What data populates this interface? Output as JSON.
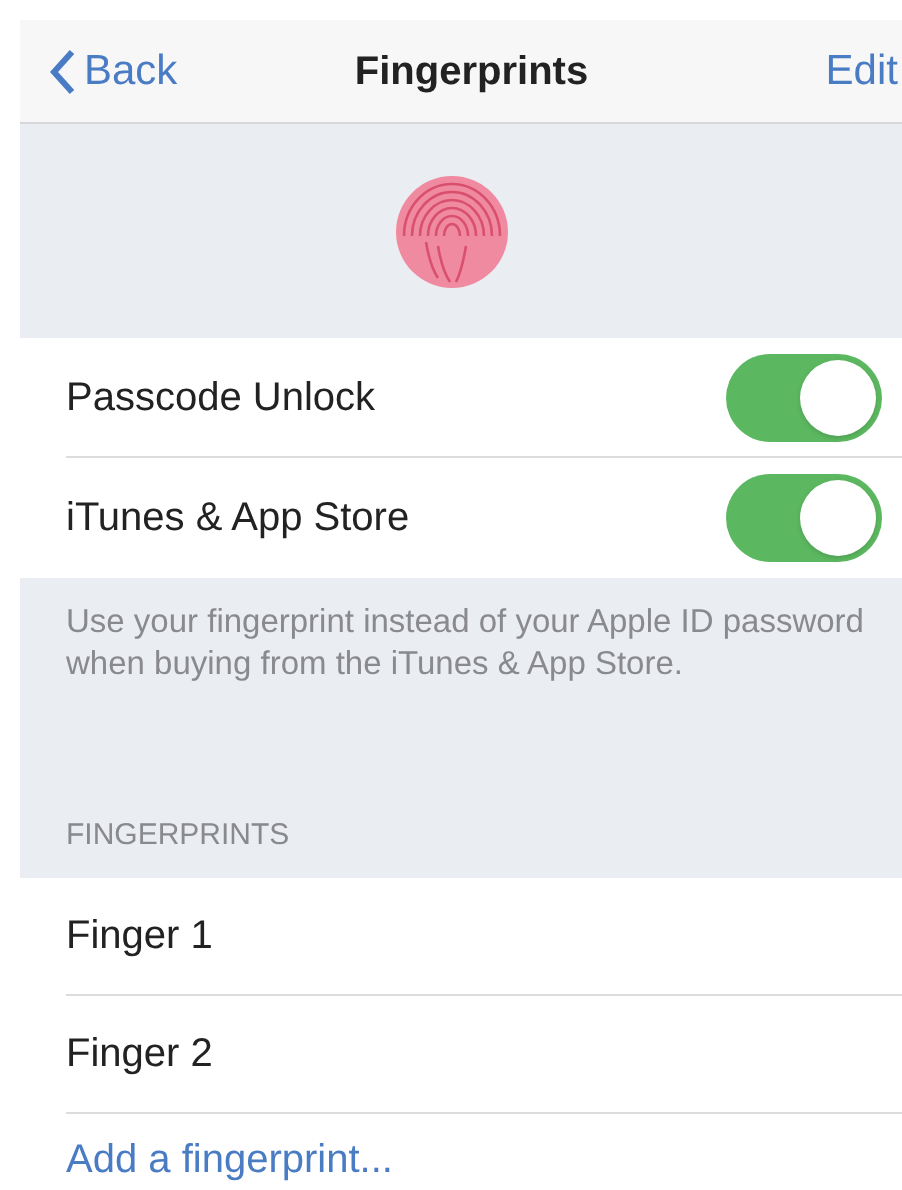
{
  "nav": {
    "back": "Back",
    "title": "Fingerprints",
    "action": "Edit"
  },
  "toggles": [
    {
      "label": "Passcode Unlock",
      "on": true
    },
    {
      "label": "iTunes & App Store",
      "on": true
    }
  ],
  "footer_note": "Use your fingerprint instead of your Apple ID password when buying from the iTunes & App Store.",
  "section_header": "FINGERPRINTS",
  "fingerprints": [
    "Finger 1",
    "Finger 2"
  ],
  "add_link": "Add a fingerprint..."
}
